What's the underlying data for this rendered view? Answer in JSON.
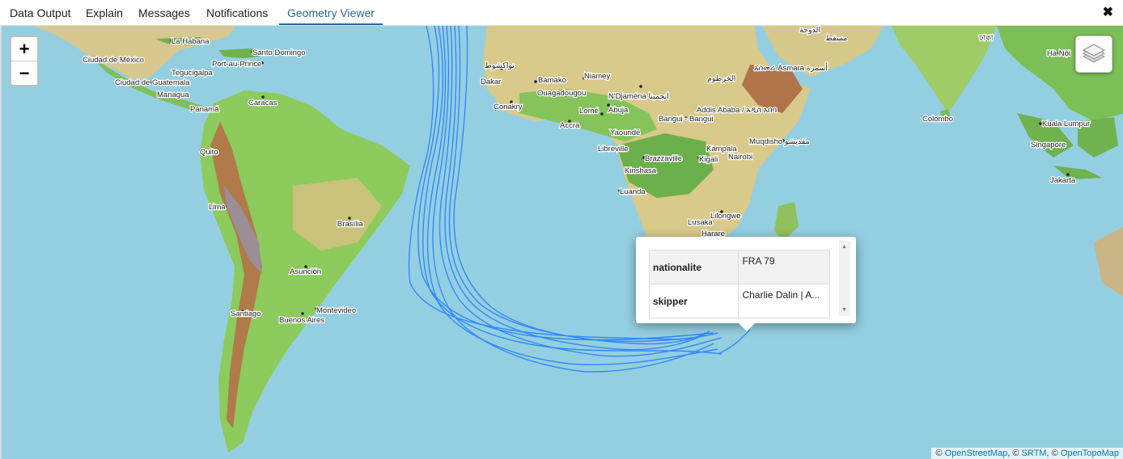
{
  "tabs": [
    {
      "label": "Data Output",
      "active": false
    },
    {
      "label": "Explain",
      "active": false
    },
    {
      "label": "Messages",
      "active": false
    },
    {
      "label": "Notifications",
      "active": false
    },
    {
      "label": "Geometry Viewer",
      "active": true
    }
  ],
  "close_label": "✖",
  "zoom": {
    "in": "+",
    "out": "−"
  },
  "layers_icon": "layers-icon",
  "cities": {
    "la_habana": "La Habana",
    "santo_domingo": "Santo Domingo",
    "ciudad_de_mexico": "Ciudad de México",
    "port_au_prince": "Port-au-Prince",
    "tegucigalpa": "Tegucigalpa",
    "ciudad_de_guatemala": "Ciudad de Guatemala",
    "managua": "Managua",
    "caracas": "Caracas",
    "panama": "Panamá",
    "quito": "Quito",
    "lima": "Lima",
    "brasilia": "Brasília",
    "asuncion": "Asunción",
    "santiago": "Santiago",
    "montevideo": "Montevideo",
    "buenos_aires": "Buenos Aires",
    "nouakchott": "نواكشوط",
    "dakar": "Dakar",
    "bamako": "Bamako",
    "niamey": "Niamey",
    "ouagadougou": "Ouagadougou",
    "conakry": "Conakry",
    "lome": "Lomé",
    "accra": "Accra",
    "abuja": "Abuja",
    "ndjamena": "N'Djaména انجمينا",
    "khartoum": "الخرطوم",
    "asmara": "አስመራ Asmara أسمرة",
    "addis_ababa": "Addis Ababa / አዲስ አበባ",
    "bangui": "Bangui - Bangui",
    "yaounde": "Yaoundé",
    "libreville": "Libreville",
    "brazzaville": "Brazzaville",
    "kinshasa": "Kinshasa",
    "kampala": "Kampala",
    "kigali": "Kigali",
    "nairobi": "Nairobi",
    "mogadishu": "Muqdisho مقديشو",
    "luanda": "Luanda",
    "lusaka": "Lusaka",
    "lilongwe": "Lilongwe",
    "harare": "Harare",
    "muscat": "مسقط",
    "doha": "الدوحة",
    "dhaka": "ঢাকা",
    "hanoi": "Hà Nội",
    "colombo": "Colombo",
    "kuala_lumpur": "Kuala Lumpur",
    "singapore": "Singapore",
    "jakarta": "Jakarta"
  },
  "popup": {
    "rows": [
      {
        "key": "nationalite",
        "value": "FRA 79"
      },
      {
        "key": "skipper",
        "value": "Charlie Dalin | A..."
      }
    ]
  },
  "attribution": {
    "prefix": "© ",
    "osm": "OpenStreetMap",
    "sep1": ", © ",
    "srtm": "SRTM",
    "sep2": ", © ",
    "otm": "OpenTopoMap"
  },
  "colors": {
    "ocean": "#94cfe1",
    "track": "#3388ff",
    "accent": "#326690"
  }
}
